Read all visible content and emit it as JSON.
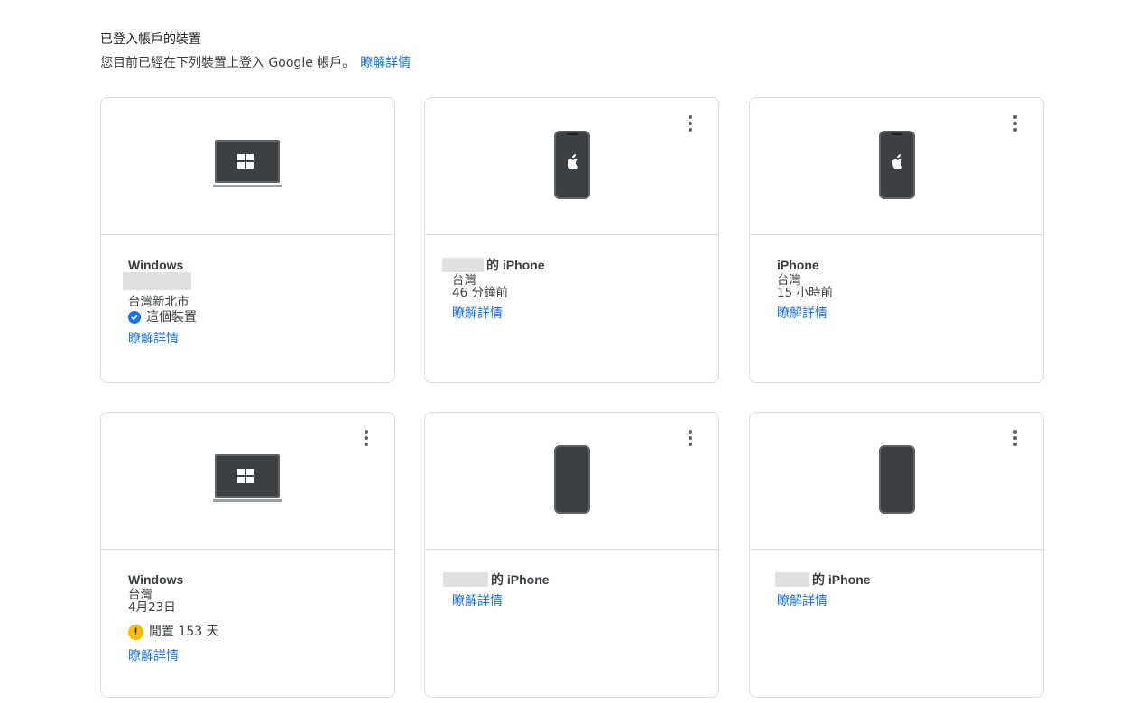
{
  "header": {
    "title": "已登入帳戶的裝置",
    "subtitle": "您目前已經在下列裝置上登入 Google 帳戶。",
    "learn_more": "瞭解詳情"
  },
  "cards": [
    {
      "name": "Windows",
      "location": "台灣新北市",
      "status": "這個裝置",
      "link": "瞭解詳情"
    },
    {
      "name_suffix": "的 iPhone",
      "location": "台灣",
      "time": "46 分鐘前",
      "link": "瞭解詳情"
    },
    {
      "name": "iPhone",
      "location": "台灣",
      "time": "15 小時前",
      "link": "瞭解詳情"
    },
    {
      "name": "Windows",
      "location": "台灣",
      "time": "4月23日",
      "status": "閒置 153 天",
      "link": "瞭解詳情"
    },
    {
      "name_suffix": "的 iPhone",
      "link": "瞭解詳情"
    },
    {
      "name_suffix": "的 iPhone",
      "link": "瞭解詳情"
    }
  ],
  "colors": {
    "link": "#1a73e8",
    "check": "#1a73e8",
    "warning": "#fbbc04",
    "border": "#dadce0"
  },
  "icons": {
    "laptop": "windows-laptop-icon",
    "phone": "iphone-icon",
    "more": "more-vert-icon",
    "check": "check-circle-icon",
    "warning": "warning-icon"
  }
}
